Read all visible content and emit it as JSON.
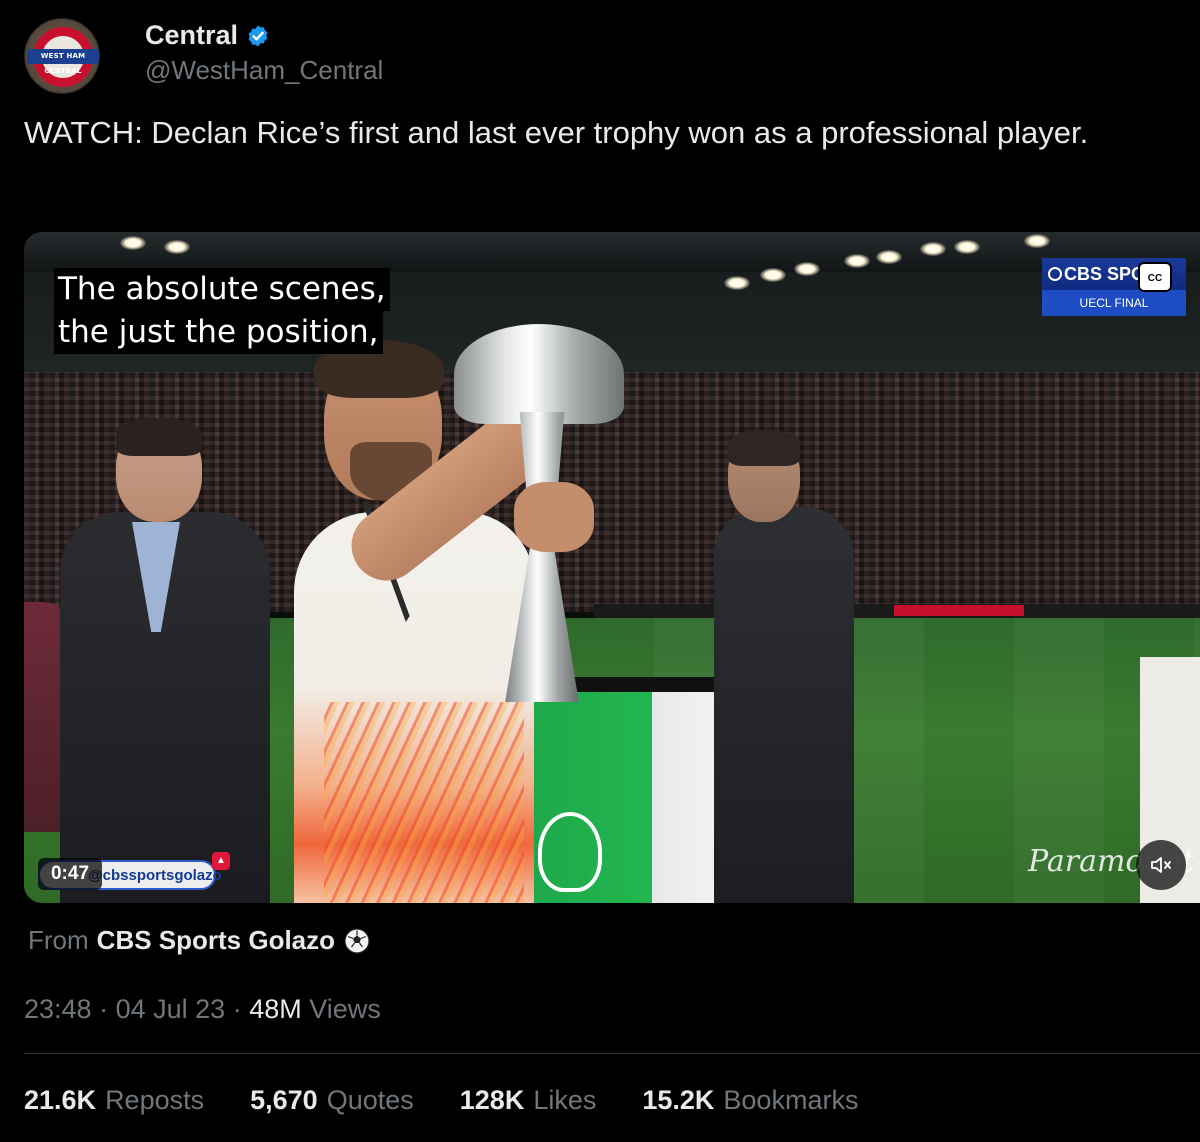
{
  "author": {
    "display_name": "Central",
    "handle": "@WestHam_Central",
    "avatar_text": "WEST HAM CENTRAL",
    "verified": true
  },
  "tweet": {
    "text": "WATCH: Declan Rice’s first and last ever trophy won as a professional player."
  },
  "media": {
    "caption_line1": "The absolute scenes,",
    "caption_line2": "the just the position,",
    "broadcaster_bug": "CBS SPORT",
    "broadcaster_sub": "UECL FINAL",
    "cc_label": "CC",
    "watermark": "@cbssportsgolazo",
    "sponsor_watermark": "Paramount",
    "duration": "0:47",
    "mute_icon": "speaker-muted-icon"
  },
  "source": {
    "prefix": "From",
    "name": "CBS Sports Golazo",
    "emoji_icon": "soccer-ball-icon"
  },
  "meta": {
    "time": "23:48",
    "date": "04 Jul 23",
    "views_count": "48M",
    "views_label": "Views",
    "separator": "·"
  },
  "stats": {
    "reposts_count": "21.6K",
    "reposts_label": "Reposts",
    "quotes_count": "5,670",
    "quotes_label": "Quotes",
    "likes_count": "128K",
    "likes_label": "Likes",
    "bookmarks_count": "15.2K",
    "bookmarks_label": "Bookmarks"
  },
  "colors": {
    "background": "#000000",
    "primary_text": "#e7e9ea",
    "secondary_text": "#71767b",
    "verified_blue": "#1d9bf0",
    "divider": "#2f3336"
  }
}
